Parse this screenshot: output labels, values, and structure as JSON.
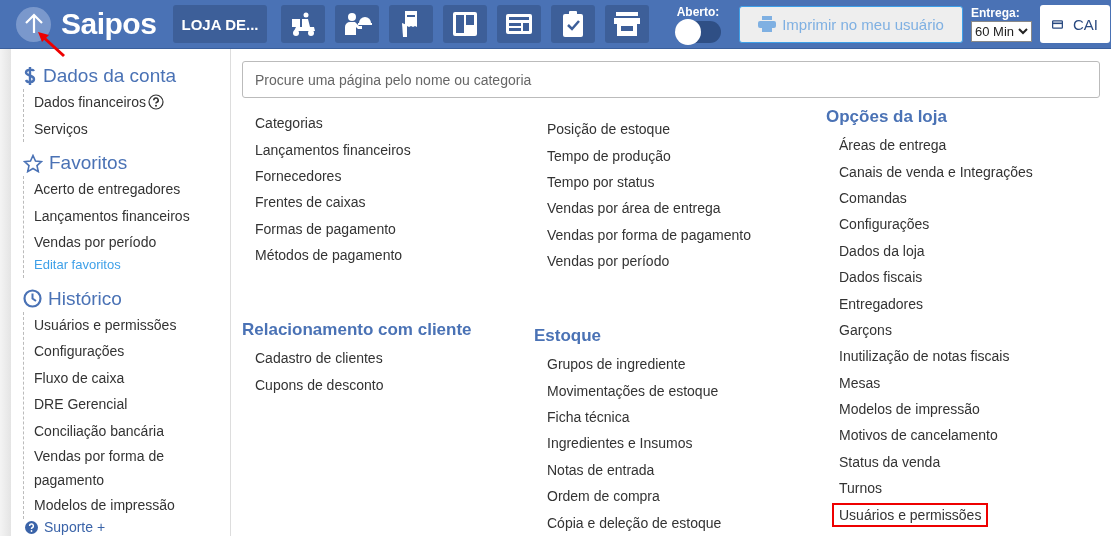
{
  "header": {
    "logo": "Saipos",
    "store_button": "LOJA DE...",
    "tool_buttons": [
      {
        "kind": "scooter"
      },
      {
        "kind": "waiter"
      },
      {
        "kind": "receipt"
      },
      {
        "kind": "board"
      },
      {
        "kind": "panel"
      },
      {
        "kind": "clipboard"
      },
      {
        "kind": "store"
      }
    ],
    "open_label": "Aberto:",
    "open_toggle": {
      "on": false
    },
    "print_button": {
      "label": "Imprimir no meu usuário",
      "disabled": true
    },
    "delivery_label": "Entrega:",
    "delivery_select": "60 Min",
    "cash_button": "CAI"
  },
  "sidebar": {
    "sections": [
      {
        "kind": "dollar",
        "title": "Dados da conta",
        "items": [
          {
            "label": "Dados financeiros",
            "help": true
          },
          {
            "label": "Serviços",
            "help": false
          }
        ]
      },
      {
        "kind": "star",
        "title": "Favoritos",
        "items": [
          {
            "label": "Acerto de entregadores",
            "help": false
          },
          {
            "label": "Lançamentos financeiros",
            "help": false
          },
          {
            "label": "Vendas por período",
            "help": false
          }
        ],
        "link": "Editar favoritos"
      },
      {
        "kind": "clock",
        "title": "Histórico",
        "items": [
          {
            "label": "Usuários e permissões",
            "help": false
          },
          {
            "label": "Configurações",
            "help": false
          },
          {
            "label": "Fluxo de caixa",
            "help": false
          },
          {
            "label": "DRE Gerencial",
            "help": false
          },
          {
            "label": "Conciliação bancária",
            "help": false
          },
          {
            "label": "Vendas por forma de pagamento",
            "help": false
          },
          {
            "label": "Modelos de impressão",
            "help": false
          }
        ]
      }
    ],
    "support": "Suporte +"
  },
  "search": {
    "placeholder": "Procure uma página pelo nome ou categoria"
  },
  "columns": [
    {
      "groups": [
        {
          "items": [
            {
              "label": "Categorias",
              "highlighted": false
            },
            {
              "label": "Lançamentos financeiros",
              "highlighted": false
            },
            {
              "label": "Fornecedores",
              "highlighted": false
            },
            {
              "label": "Frentes de caixas",
              "highlighted": false
            },
            {
              "label": "Formas de pagamento",
              "highlighted": false
            },
            {
              "label": "Métodos de pagamento",
              "highlighted": false
            }
          ]
        },
        {
          "title": "Relacionamento com cliente",
          "items": [
            {
              "label": "Cadastro de clientes",
              "highlighted": false
            },
            {
              "label": "Cupons de desconto",
              "highlighted": false
            }
          ]
        }
      ]
    },
    {
      "groups": [
        {
          "items": [
            {
              "label": "Posição de estoque",
              "highlighted": false
            },
            {
              "label": "Tempo de produção",
              "highlighted": false
            },
            {
              "label": "Tempo por status",
              "highlighted": false
            },
            {
              "label": "Vendas por área de entrega",
              "highlighted": false
            },
            {
              "label": "Vendas por forma de pagamento",
              "highlighted": false
            },
            {
              "label": "Vendas por período",
              "highlighted": false
            }
          ]
        },
        {
          "title": "Estoque",
          "items": [
            {
              "label": "Grupos de ingrediente",
              "highlighted": false
            },
            {
              "label": "Movimentações de estoque",
              "highlighted": false
            },
            {
              "label": "Ficha técnica",
              "highlighted": false
            },
            {
              "label": "Ingredientes e Insumos",
              "highlighted": false
            },
            {
              "label": "Notas de entrada",
              "highlighted": false
            },
            {
              "label": "Ordem de compra",
              "highlighted": false
            },
            {
              "label": "Cópia e deleção de estoque",
              "highlighted": false
            }
          ]
        }
      ]
    },
    {
      "groups": [
        {
          "title": "Opções da loja",
          "items": [
            {
              "label": "Áreas de entrega",
              "highlighted": false
            },
            {
              "label": "Canais de venda e Integrações",
              "highlighted": false
            },
            {
              "label": "Comandas",
              "highlighted": false
            },
            {
              "label": "Configurações",
              "highlighted": false
            },
            {
              "label": "Dados da loja",
              "highlighted": false
            },
            {
              "label": "Dados fiscais",
              "highlighted": false
            },
            {
              "label": "Entregadores",
              "highlighted": false
            },
            {
              "label": "Garçons",
              "highlighted": false
            },
            {
              "label": "Inutilização de notas fiscais",
              "highlighted": false
            },
            {
              "label": "Mesas",
              "highlighted": false
            },
            {
              "label": "Modelos de impressão",
              "highlighted": false
            },
            {
              "label": "Motivos de cancelamento",
              "highlighted": false
            },
            {
              "label": "Status da venda",
              "highlighted": false
            },
            {
              "label": "Turnos",
              "highlighted": false
            },
            {
              "label": "Usuários e permissões",
              "highlighted": true
            }
          ]
        }
      ]
    }
  ]
}
